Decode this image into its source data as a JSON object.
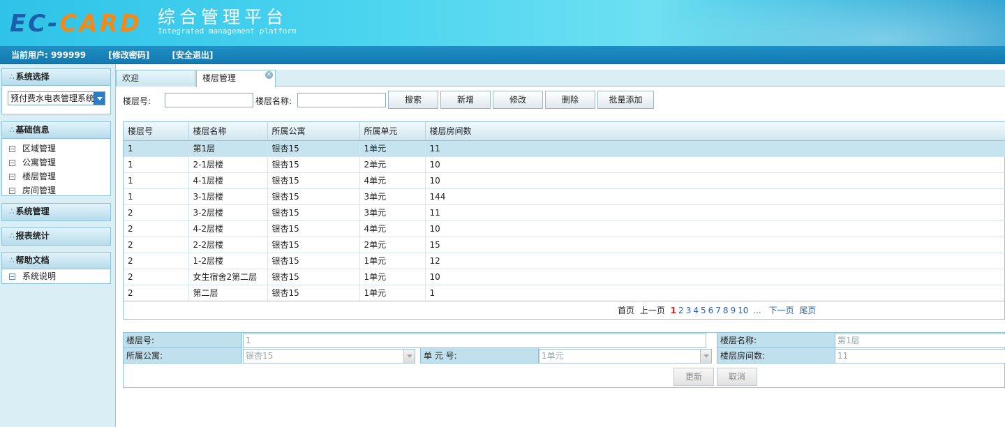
{
  "header": {
    "logo_part1": "EC-",
    "logo_part2": "CARD",
    "title": "综合管理平台",
    "subtitle": "Integrated management platform"
  },
  "userbar": {
    "current_user": "当前用户: 999999",
    "change_password": "[修改密码]",
    "logout": "[安全退出]"
  },
  "sidebar": {
    "system_select": {
      "title": "系统选择",
      "selected": "预付费水电表管理系统"
    },
    "basic_info": {
      "title": "基础信息",
      "items": [
        "区域管理",
        "公寓管理",
        "楼层管理",
        "房间管理"
      ]
    },
    "system_manage": {
      "title": "系统管理"
    },
    "reports": {
      "title": "报表统计"
    },
    "help": {
      "title": "帮助文档",
      "items": [
        "系统说明"
      ]
    }
  },
  "tabs": [
    {
      "label": "欢迎"
    },
    {
      "label": "楼层管理"
    }
  ],
  "search": {
    "floor_no_label": "楼层号:",
    "floor_name_label": "楼层名称:",
    "floor_no_value": "",
    "floor_name_value": "",
    "buttons": {
      "search": "搜索",
      "add": "新增",
      "edit": "修改",
      "delete": "删除",
      "batch_add": "批量添加"
    }
  },
  "table": {
    "columns": [
      "楼层号",
      "楼层名称",
      "所属公寓",
      "所属单元",
      "楼层房间数"
    ],
    "rows": [
      [
        "1",
        "第1层",
        "银杏15",
        "1单元",
        "11"
      ],
      [
        "1",
        "2-1层楼",
        "银杏15",
        "2单元",
        "10"
      ],
      [
        "1",
        "4-1层楼",
        "银杏15",
        "4单元",
        "10"
      ],
      [
        "1",
        "3-1层楼",
        "银杏15",
        "3单元",
        "144"
      ],
      [
        "2",
        "3-2层楼",
        "银杏15",
        "3单元",
        "11"
      ],
      [
        "2",
        "4-2层楼",
        "银杏15",
        "4单元",
        "10"
      ],
      [
        "2",
        "2-2层楼",
        "银杏15",
        "2单元",
        "15"
      ],
      [
        "2",
        "1-2层楼",
        "银杏15",
        "1单元",
        "12"
      ],
      [
        "2",
        "女生宿舍2第二层",
        "银杏15",
        "1单元",
        "10"
      ],
      [
        "2",
        "第二层",
        "银杏15",
        "1单元",
        "1"
      ]
    ],
    "selected_row": 0
  },
  "pager": {
    "first": "首页",
    "prev": "上一页",
    "pages": [
      "1",
      "2",
      "3",
      "4",
      "5",
      "6",
      "7",
      "8",
      "9",
      "10"
    ],
    "current": "1",
    "ellipsis": "...",
    "next": "下一页",
    "last": "尾页"
  },
  "form": {
    "floor_no_label": "楼层号:",
    "floor_no_value": "1",
    "floor_name_label": "楼层名称:",
    "floor_name_value": "第1层",
    "apartment_label": "所属公寓:",
    "apartment_value": "银杏15",
    "unit_label": "单 元 号:",
    "unit_value": "1单元",
    "room_count_label": "楼层房间数:",
    "room_count_value": "11",
    "update_button": "更新",
    "cancel_button": "取消"
  }
}
